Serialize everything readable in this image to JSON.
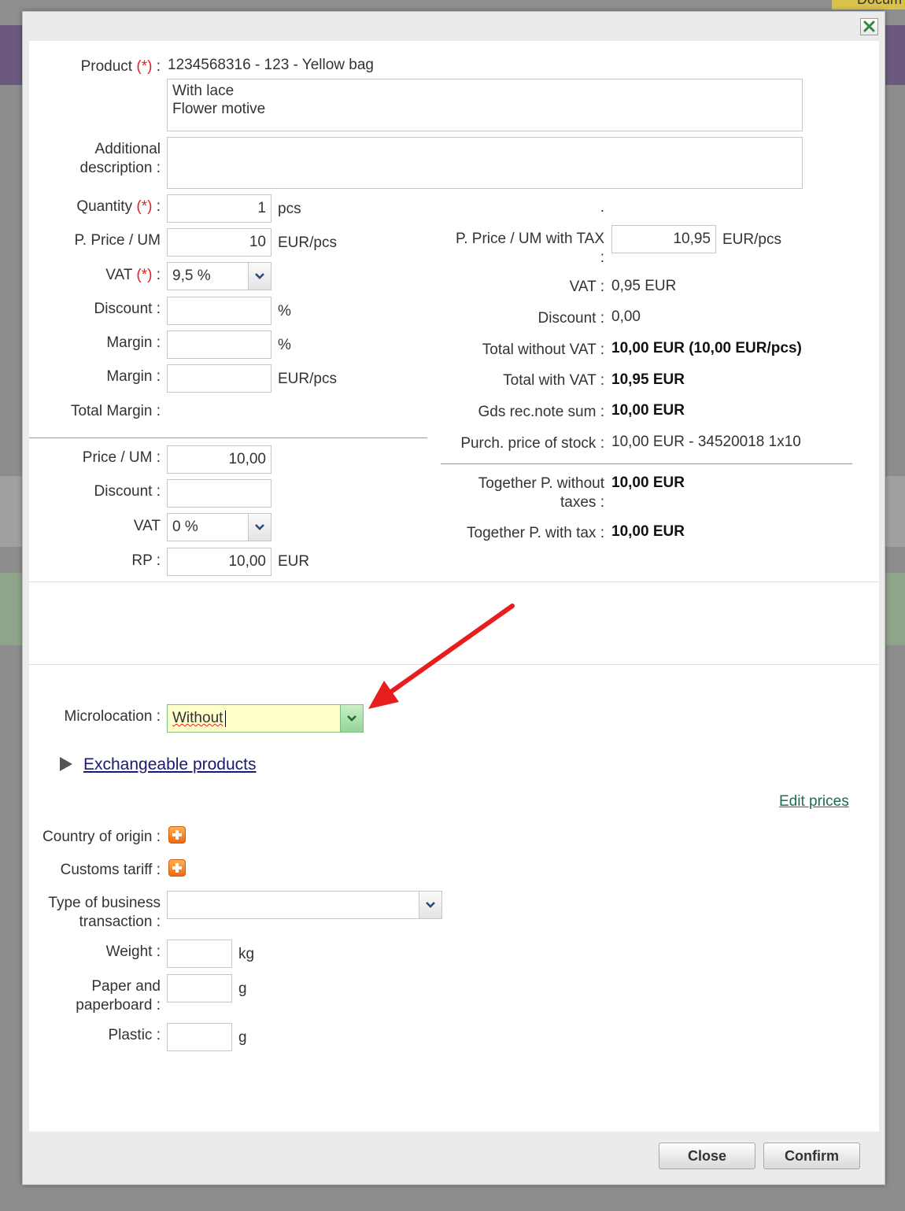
{
  "background": {
    "corner_tab": "Docum"
  },
  "dialog": {
    "close_icon": "close-x-icon",
    "product": {
      "label": "Product",
      "required": "(*)",
      "colon": ":",
      "value": "1234568316 - 123 - Yellow bag",
      "description_line1": "With lace",
      "description_line2": "Flower motive"
    },
    "additional_description": {
      "label_line1": "Additional",
      "label_line2": "description :",
      "value": ""
    },
    "left": {
      "quantity": {
        "label": "Quantity",
        "required": "(*)",
        "colon": ":",
        "value": "1",
        "unit": "pcs"
      },
      "p_price_um": {
        "label": "P. Price / UM",
        "value": "10",
        "unit": "EUR/pcs"
      },
      "vat": {
        "label": "VAT",
        "required": "(*)",
        "colon": ":",
        "value": "9,5 %"
      },
      "discount": {
        "label": "Discount :",
        "value": "",
        "unit": "%"
      },
      "margin_pct": {
        "label": "Margin :",
        "value": "",
        "unit": "%"
      },
      "margin_eur": {
        "label": "Margin :",
        "value": "",
        "unit": "EUR/pcs"
      },
      "total_margin": {
        "label": "Total Margin :"
      }
    },
    "retail": {
      "price_um": {
        "label": "Price / UM :",
        "value": "10,00"
      },
      "discount": {
        "label": "Discount :",
        "value": ""
      },
      "vat": {
        "label": "VAT",
        "value": "0 %"
      },
      "rp": {
        "label": "RP :",
        "value": "10,00",
        "unit": "EUR"
      }
    },
    "right": {
      "dot": ".",
      "p_price_tax": {
        "label": "P. Price / UM with TAX",
        "colon": ":",
        "value": "10,95",
        "unit": "EUR/pcs"
      },
      "vat": {
        "label": "VAT :",
        "value": "0,95 EUR"
      },
      "discount": {
        "label": "Discount :",
        "value": "0,00"
      },
      "total_without_vat": {
        "label": "Total without VAT :",
        "value": "10,00 EUR (10,00 EUR/pcs)"
      },
      "total_with_vat": {
        "label": "Total with VAT :",
        "value": "10,95 EUR"
      },
      "gds_rec_note_sum": {
        "label": "Gds rec.note sum :",
        "value": "10,00 EUR"
      },
      "purch_price_stock": {
        "label": "Purch. price of stock :",
        "value": "10,00 EUR - 34520018 1x10"
      },
      "together_without_taxes": {
        "label_line1": "Together P. without",
        "label_line2": "taxes :",
        "value": "10,00 EUR"
      },
      "together_with_tax": {
        "label": "Together P. with tax :",
        "value": "10,00 EUR"
      }
    },
    "microlocation": {
      "label": "Microlocation :",
      "value": "Without"
    },
    "exchangeable": {
      "label": "Exchangeable products"
    },
    "edit_prices": "Edit prices",
    "country_of_origin": {
      "label": "Country of origin :"
    },
    "customs_tariff": {
      "label": "Customs tariff :"
    },
    "business_transaction": {
      "label_line1": "Type of business",
      "label_line2": "transaction :",
      "value": ""
    },
    "weight": {
      "label": "Weight :",
      "value": "",
      "unit": "kg"
    },
    "paper": {
      "label_line1": "Paper and",
      "label_line2": "paperboard :",
      "value": "",
      "unit": "g"
    },
    "plastic": {
      "label": "Plastic :",
      "value": "",
      "unit": "g"
    },
    "buttons": {
      "close": "Close",
      "confirm": "Confirm"
    }
  },
  "colors": {
    "accent_purple": "#6b5a7e",
    "highlight_yellow": "#ffffcc",
    "arrow_red": "#e81d1d",
    "link_green": "#1f6b4f",
    "link_navy": "#1a1a6e"
  }
}
